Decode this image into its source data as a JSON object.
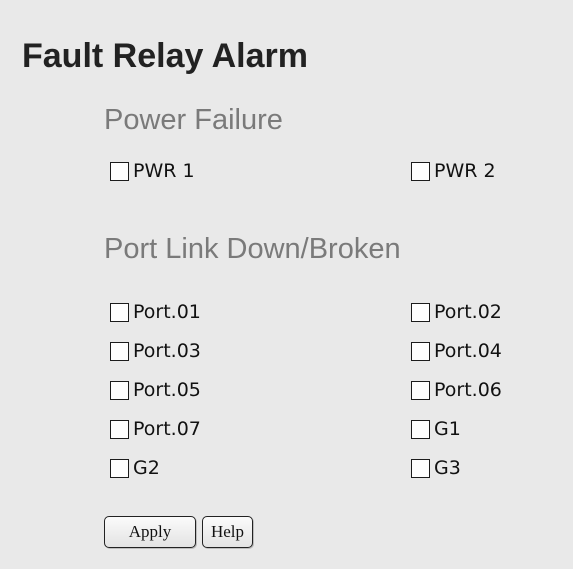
{
  "page": {
    "title": "Fault Relay Alarm"
  },
  "power_failure": {
    "heading": "Power Failure",
    "items": [
      {
        "label": "PWR 1",
        "checked": false
      },
      {
        "label": "PWR 2",
        "checked": false
      }
    ]
  },
  "port_link": {
    "heading": "Port Link Down/Broken",
    "items": [
      {
        "label": "Port.01",
        "checked": false
      },
      {
        "label": "Port.02",
        "checked": false
      },
      {
        "label": "Port.03",
        "checked": false
      },
      {
        "label": "Port.04",
        "checked": false
      },
      {
        "label": "Port.05",
        "checked": false
      },
      {
        "label": "Port.06",
        "checked": false
      },
      {
        "label": "Port.07",
        "checked": false
      },
      {
        "label": "G1",
        "checked": false
      },
      {
        "label": "G2",
        "checked": false
      },
      {
        "label": "G3",
        "checked": false
      }
    ]
  },
  "buttons": {
    "apply_label": "Apply",
    "help_label": "Help"
  },
  "colors": {
    "background": "#e9e9e9",
    "title": "#222222",
    "section_heading": "#7a7a7a"
  }
}
